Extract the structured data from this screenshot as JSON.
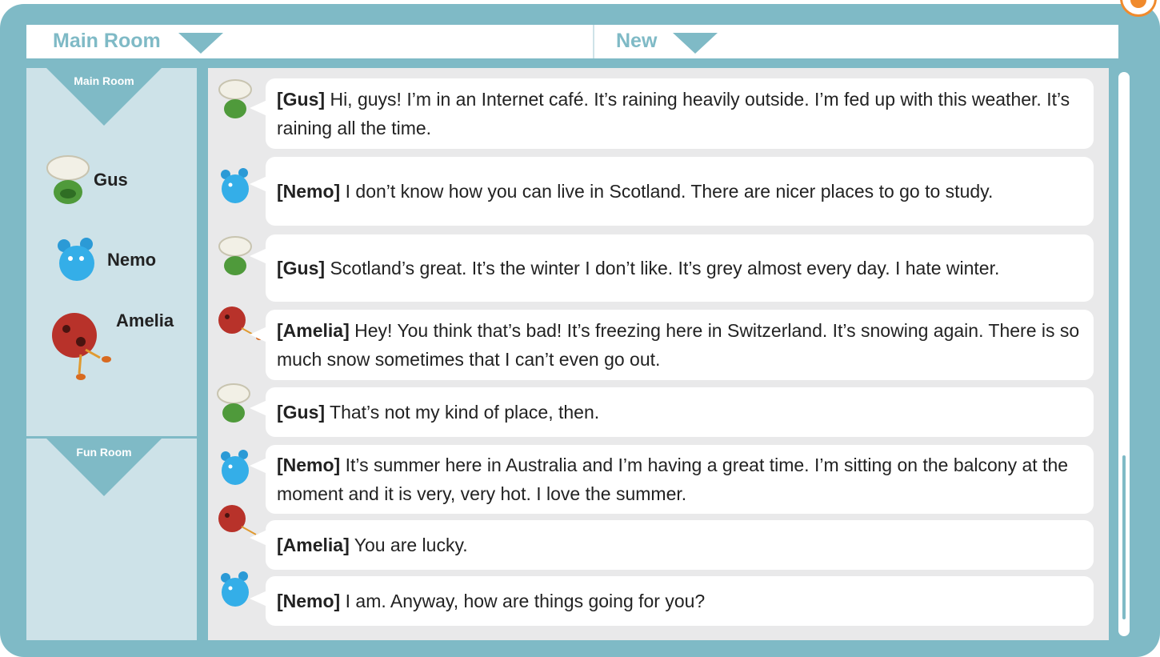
{
  "header": {
    "room_selector": "Main Room",
    "new_selector": "New"
  },
  "sidebar": {
    "main_room_label": "Main Room",
    "fun_room_label": "Fun Room",
    "users": [
      {
        "name": "Gus",
        "avatar": "chef-hat-avatar"
      },
      {
        "name": "Nemo",
        "avatar": "blue-bear-avatar"
      },
      {
        "name": "Amelia",
        "avatar": "ladybug-avatar"
      }
    ]
  },
  "messages": [
    {
      "author": "[Gus]",
      "text": " Hi, guys! I’m in an Internet café. It’s raining heavily outside. I’m fed up with this weather. It’s raining all the time."
    },
    {
      "author": "[Nemo]",
      "text": " I don’t know how you can live in Scotland. There are nicer places to go to study."
    },
    {
      "author": "[Gus]",
      "text": " Scotland’s great. It’s the winter I don’t like. It’s grey almost every day. I hate winter."
    },
    {
      "author": "[Amelia]",
      "text": " Hey! You think that’s bad! It’s freezing here in Switzerland. It’s snowing again. There is so much snow sometimes that I can’t even go out."
    },
    {
      "author": "[Gus]",
      "text": " That’s not my kind of place, then."
    },
    {
      "author": "[Nemo]",
      "text": " It’s summer here in Australia and I’m having a great time. I’m sitting on the balcony at the moment and it is very, very hot. I love the summer."
    },
    {
      "author": "[Amelia]",
      "text": " You are lucky."
    },
    {
      "author": "[Nemo]",
      "text": " I am. Anyway, how are things going for you?"
    }
  ],
  "colors": {
    "frame": "#7fbac6",
    "sidebar": "#cde2e8",
    "chat_bg": "#e9e9ea",
    "accent_orange": "#f08a2c"
  }
}
